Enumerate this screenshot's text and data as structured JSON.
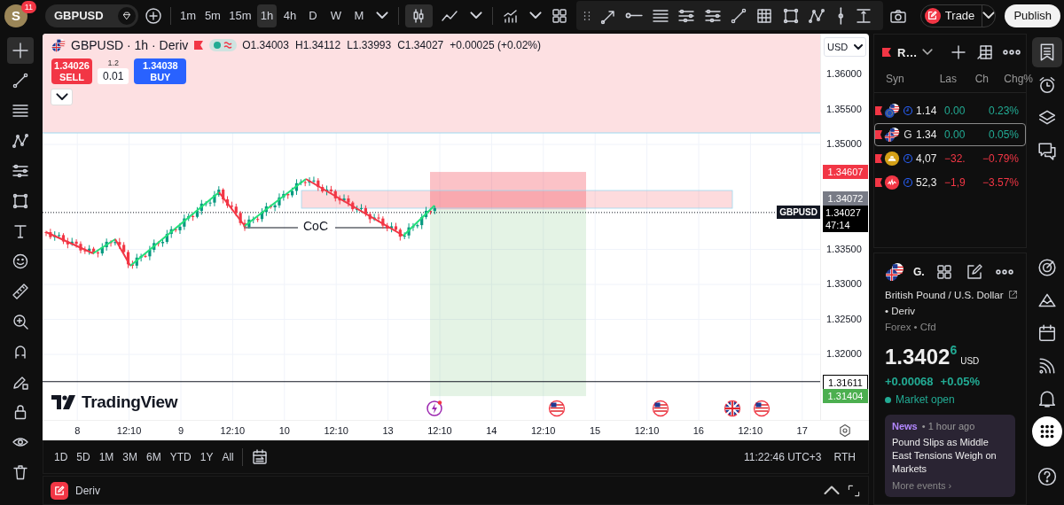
{
  "top_bar": {
    "avatar": "S",
    "notification_count": "11",
    "symbol": "GBPUSD",
    "intervals": [
      {
        "label": "1m",
        "selected": false
      },
      {
        "label": "5m",
        "selected": false
      },
      {
        "label": "15m",
        "selected": false
      },
      {
        "label": "1h",
        "selected": true
      },
      {
        "label": "4h",
        "selected": false
      },
      {
        "label": "D",
        "selected": false
      },
      {
        "label": "W",
        "selected": false
      },
      {
        "label": "M",
        "selected": false
      }
    ],
    "chart_types": [
      {
        "kind": "candles",
        "selected": true
      },
      {
        "kind": "line",
        "selected": false
      }
    ],
    "trade_button": "Trade",
    "publish_button": "Publish"
  },
  "left_toolbar": [
    {
      "kind": "crosshair",
      "selected": true
    },
    {
      "kind": "trend",
      "selected": false
    },
    {
      "kind": "hlines",
      "selected": false
    },
    {
      "kind": "pattern",
      "selected": false
    },
    {
      "kind": "sliders",
      "selected": false
    },
    {
      "kind": "rect",
      "selected": false
    },
    {
      "kind": "text",
      "selected": false
    },
    {
      "kind": "smiley",
      "selected": false
    },
    {
      "kind": "ruler",
      "selected": false
    },
    {
      "kind": "zoom",
      "selected": false
    },
    {
      "kind": "magnet",
      "selected": false
    },
    {
      "kind": "pencillock",
      "selected": false
    },
    {
      "kind": "lock",
      "selected": false
    },
    {
      "kind": "eye",
      "selected": false
    },
    {
      "kind": "trash",
      "selected": false
    }
  ],
  "chart": {
    "legend": {
      "title": "GBPUSD · 1h · Deriv",
      "values": [
        "O1.34003",
        "H1.34112",
        "L1.33993",
        "C1.34027",
        "+0.00025 (+0.02%)"
      ]
    },
    "trade_panel": {
      "sell_price": "1.34026",
      "sell_label": "SELL",
      "spread": "1.2",
      "quantity": "0.01",
      "buy_price": "1.34038",
      "buy_label": "BUY"
    },
    "annotation": "CoC",
    "logo": "TradingView",
    "events": [
      {
        "kind": "flash"
      },
      {
        "kind": "us"
      },
      {
        "kind": "us"
      },
      {
        "kind": "uk"
      },
      {
        "kind": "us"
      }
    ],
    "price_axis": {
      "currency": "USD",
      "labels": [
        "1.36000",
        "1.35500",
        "1.35000",
        "1.33500",
        "1.33000",
        "1.32500",
        "1.32000"
      ],
      "tags": [
        {
          "kind": "alert",
          "text": "1.34607"
        },
        {
          "kind": "high",
          "text": "1.34072"
        },
        {
          "kind": "last",
          "symbol": "GBPUSD",
          "text": "1.34027",
          "countdown": "47:14"
        },
        {
          "kind": "line",
          "text": "1.31611"
        },
        {
          "kind": "target",
          "text": "1.31404"
        }
      ]
    },
    "time_axis": [
      "8",
      "12:10",
      "9",
      "12:10",
      "10",
      "12:10",
      "13",
      "12:10",
      "14",
      "12:10",
      "15",
      "12:10",
      "16",
      "12:10",
      "17"
    ]
  },
  "range_bar": {
    "ranges": [
      "1D",
      "5D",
      "1M",
      "3M",
      "6M",
      "YTD",
      "1Y",
      "All"
    ],
    "time": "11:22:46 UTC+3",
    "session": "RTH"
  },
  "bottom_panel": {
    "title": "Deriv"
  },
  "watchlist": {
    "title": "R…",
    "columns": [
      "Syn",
      "Las",
      "Ch",
      "Chg%"
    ],
    "rows": [
      {
        "kind": "euus",
        "symbol": "",
        "last": "1.14",
        "change": "0.00",
        "percent": "0.23%",
        "color": "#22ab94",
        "selected": false
      },
      {
        "kind": "gbus",
        "symbol": "G",
        "last": "1.34",
        "change": "0.00",
        "percent": "0.05%",
        "color": "#22ab94",
        "selected": true
      },
      {
        "kind": "gold",
        "symbol": "",
        "last": "4,07",
        "change": "−32.",
        "percent": "−0.79%",
        "color": "#f23645",
        "selected": false
      },
      {
        "kind": "index",
        "symbol": "",
        "last": "52,3",
        "change": "−1,9",
        "percent": "−3.57%",
        "color": "#f23645",
        "selected": false
      }
    ]
  },
  "details": {
    "symbol": "G.",
    "name": "British Pound / U.S. Dollar",
    "exchange": "• Deriv",
    "category": "Forex • Cfd",
    "price": "1.3402$^{6}$",
    "currency": "USD",
    "change": "+0.00068",
    "percent": "+0.05%",
    "status": "Market open",
    "news": {
      "tag": "News",
      "time": "• 1 hour ago",
      "headline": "Pound Slips as Middle East Tensions Weigh on Markets",
      "more": "More events ›"
    }
  },
  "right_sidebar": [
    {
      "kind": "watchlist",
      "selected": true
    },
    {
      "kind": "alarm",
      "selected": false
    },
    {
      "kind": "layers",
      "selected": false
    },
    {
      "kind": "chat",
      "selected": false
    },
    {
      "kind": "target",
      "selected": false
    },
    {
      "kind": "ideas",
      "selected": false
    },
    {
      "kind": "calendar",
      "selected": false
    },
    {
      "kind": "signal",
      "selected": false
    },
    {
      "kind": "bell",
      "selected": false
    },
    {
      "kind": "apps",
      "selected": false
    },
    {
      "kind": "help",
      "selected": false
    }
  ]
}
